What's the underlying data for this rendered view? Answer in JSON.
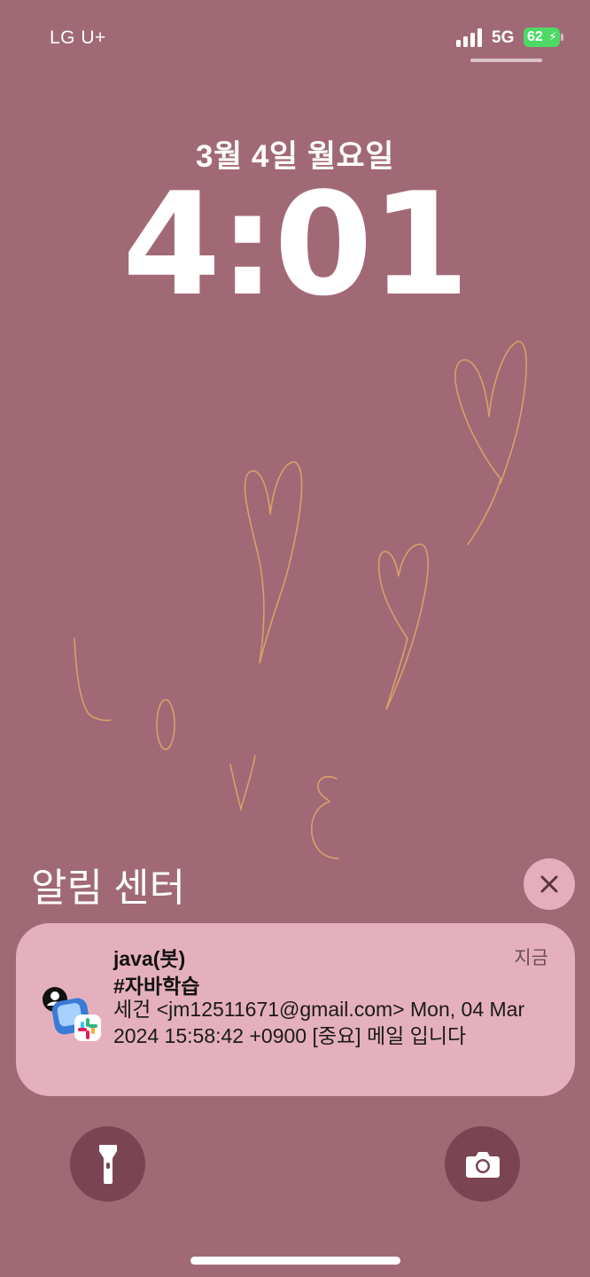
{
  "status_bar": {
    "carrier": "LG U+",
    "network": "5G",
    "battery_level": "62",
    "battery_color": "#4cd964"
  },
  "lock_screen": {
    "date": "3월 4일 월요일",
    "time": "4:01"
  },
  "notification_center": {
    "title": "알림 센터",
    "close_icon": "close-icon"
  },
  "notification": {
    "app_icon": "slack-icon",
    "title": "java(봇)",
    "subtitle": "#자바학습",
    "time": "지금",
    "body": "세건 <jm12511671@gmail.com> Mon, 04 Mar 2024 15:58:42 +0900 [중요] 메일 입니다"
  },
  "quick_actions": {
    "left_icon": "flashlight-icon",
    "right_icon": "camera-icon"
  },
  "colors": {
    "background": "#a16976",
    "notification_bg": "#e5b0be",
    "button_bg": "#7a4452"
  }
}
